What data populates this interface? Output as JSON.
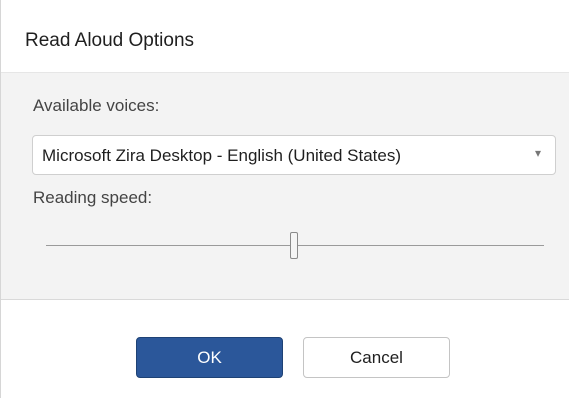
{
  "dialog": {
    "title": "Read Aloud Options"
  },
  "voices": {
    "label": "Available voices:",
    "selected": "Microsoft Zira Desktop - English (United States)",
    "chevron_icon": "chevron-down-icon"
  },
  "speed": {
    "label": "Reading speed:",
    "value_fraction": 0.5
  },
  "buttons": {
    "ok_label": "OK",
    "cancel_label": "Cancel"
  },
  "colors": {
    "accent": "#2b579a",
    "content_background": "#f3f3f3"
  }
}
